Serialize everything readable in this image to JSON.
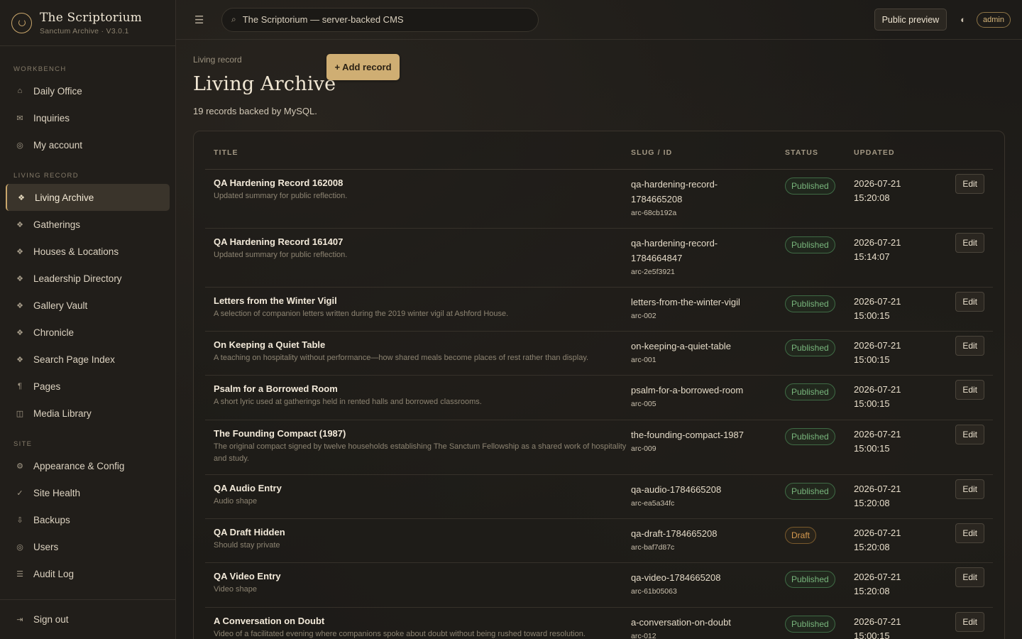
{
  "app": {
    "brand_title": "The Scriptorium",
    "brand_sub": "Sanctum Archive · V3.0.1"
  },
  "sidebar": {
    "sections": [
      {
        "label": "WORKBENCH",
        "items": [
          {
            "label": "Daily Office",
            "icon": "⌂",
            "active": false
          },
          {
            "label": "Inquiries",
            "icon": "✉",
            "active": false
          },
          {
            "label": "My account",
            "icon": "◎",
            "active": false
          }
        ]
      },
      {
        "label": "LIVING RECORD",
        "items": [
          {
            "label": "Living Archive",
            "icon": "❖",
            "active": true
          },
          {
            "label": "Gatherings",
            "icon": "❖",
            "active": false
          },
          {
            "label": "Houses & Locations",
            "icon": "❖",
            "active": false
          },
          {
            "label": "Leadership Directory",
            "icon": "❖",
            "active": false
          },
          {
            "label": "Gallery Vault",
            "icon": "❖",
            "active": false
          },
          {
            "label": "Chronicle",
            "icon": "❖",
            "active": false
          },
          {
            "label": "Search Page Index",
            "icon": "❖",
            "active": false
          },
          {
            "label": "Pages",
            "icon": "¶",
            "active": false
          },
          {
            "label": "Media Library",
            "icon": "◫",
            "active": false
          }
        ]
      },
      {
        "label": "SITE",
        "items": [
          {
            "label": "Appearance & Config",
            "icon": "⚙",
            "active": false
          },
          {
            "label": "Site Health",
            "icon": "✓",
            "active": false
          },
          {
            "label": "Backups",
            "icon": "⇩",
            "active": false
          },
          {
            "label": "Users",
            "icon": "◎",
            "active": false
          },
          {
            "label": "Audit Log",
            "icon": "☰",
            "active": false
          }
        ]
      }
    ],
    "signout": {
      "label": "Sign out",
      "icon": "⇥"
    }
  },
  "topbar": {
    "search_value": "The Scriptorium — server-backed CMS",
    "preview_label": "Public preview",
    "user_badge": "admin"
  },
  "page": {
    "breadcrumb": "Living record",
    "title": "Living Archive",
    "add_label": "+ Add record",
    "subtitle": "19 records backed by MySQL."
  },
  "table": {
    "headers": {
      "title": "TITLE",
      "slug": "SLUG / ID",
      "status": "STATUS",
      "updated": "UPDATED"
    },
    "edit_label": "Edit",
    "rows": [
      {
        "title": "QA Hardening Record 162008",
        "summary": "Updated summary for public reflection.",
        "slug": "qa-hardening-record-1784665208",
        "slug_lines": [
          "qa-hardening-record-",
          "1784665208"
        ],
        "id": "arc-68cb192a",
        "status": "Published",
        "date": "2026-07-21",
        "time": "15:20:08"
      },
      {
        "title": "QA Hardening Record 161407",
        "summary": "Updated summary for public reflection.",
        "slug": "qa-hardening-record-1784664847",
        "slug_lines": [
          "qa-hardening-record-",
          "1784664847"
        ],
        "id": "arc-2e5f3921",
        "status": "Published",
        "date": "2026-07-21",
        "time": "15:14:07"
      },
      {
        "title": "Letters from the Winter Vigil",
        "summary": "A selection of companion letters written during the 2019 winter vigil at Ashford House.",
        "slug_lines": [
          "letters-from-the-winter-vigil"
        ],
        "id": "arc-002",
        "status": "Published",
        "date": "2026-07-21",
        "time": "15:00:15"
      },
      {
        "title": "On Keeping a Quiet Table",
        "summary": "A teaching on hospitality without performance—how shared meals become places of rest rather than display.",
        "slug_lines": [
          "on-keeping-a-quiet-table"
        ],
        "id": "arc-001",
        "status": "Published",
        "date": "2026-07-21",
        "time": "15:00:15"
      },
      {
        "title": "Psalm for a Borrowed Room",
        "summary": "A short lyric used at gatherings held in rented halls and borrowed classrooms.",
        "slug_lines": [
          "psalm-for-a-borrowed-room"
        ],
        "id": "arc-005",
        "status": "Published",
        "date": "2026-07-21",
        "time": "15:00:15"
      },
      {
        "title": "The Founding Compact (1987)",
        "summary": "The original compact signed by twelve households establishing The Sanctum Fellowship as a shared work of hospitality and study.",
        "slug_lines": [
          "the-founding-compact-1987"
        ],
        "id": "arc-009",
        "status": "Published",
        "date": "2026-07-21",
        "time": "15:00:15"
      },
      {
        "title": "QA Audio Entry",
        "summary": "Audio shape",
        "slug_lines": [
          "qa-audio-1784665208"
        ],
        "id": "arc-ea5a34fc",
        "status": "Published",
        "date": "2026-07-21",
        "time": "15:20:08"
      },
      {
        "title": "QA Draft Hidden",
        "summary": "Should stay private",
        "slug_lines": [
          "qa-draft-1784665208"
        ],
        "id": "arc-baf7d87c",
        "status": "Draft",
        "date": "2026-07-21",
        "time": "15:20:08"
      },
      {
        "title": "QA Video Entry",
        "summary": "Video shape",
        "slug_lines": [
          "qa-video-1784665208"
        ],
        "id": "arc-61b05063",
        "status": "Published",
        "date": "2026-07-21",
        "time": "15:20:08"
      },
      {
        "title": "A Conversation on Doubt",
        "summary": "Video of a facilitated evening where companions spoke about doubt without being rushed toward resolution.",
        "slug_lines": [
          "a-conversation-on-doubt"
        ],
        "id": "arc-012",
        "status": "Published",
        "date": "2026-07-21",
        "time": "15:00:15"
      }
    ]
  },
  "colors": {
    "accent": "#cfae73",
    "published": "#78b57c",
    "draft": "#d69a4f",
    "background": "#1c1a17"
  }
}
